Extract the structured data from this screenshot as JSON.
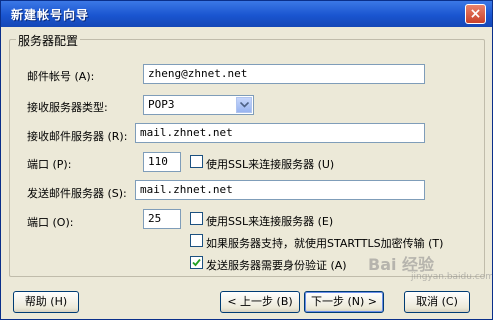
{
  "window": {
    "title": "新建帐号向导",
    "close_glyph": "×"
  },
  "group": {
    "title": "服务器配置"
  },
  "form": {
    "email_label": "邮件帐号 (A):",
    "email_value": "zheng@zhnet.net",
    "server_type_label": "接收服务器类型:",
    "server_type_value": "POP3",
    "incoming_label": "接收邮件服务器 (R):",
    "incoming_value": "mail.zhnet.net",
    "in_port_label": "端口 (P):",
    "in_port_value": "110",
    "in_ssl_label": "使用SSL来连接服务器 (U)",
    "in_ssl_checked": false,
    "outgoing_label": "发送邮件服务器 (S):",
    "outgoing_value": "mail.zhnet.net",
    "out_port_label": "端口 (O):",
    "out_port_value": "25",
    "out_ssl_label": "使用SSL来连接服务器 (E)",
    "out_ssl_checked": false,
    "starttls_label": "如果服务器支持，就使用STARTTLS加密传输 (T)",
    "starttls_checked": false,
    "auth_label": "发送服务器需要身份验证 (A)",
    "auth_checked": true
  },
  "buttons": {
    "help": "帮助 (H)",
    "back": "< 上一步 (B)",
    "next": "下一步 (N) >",
    "cancel": "取消 (C)"
  },
  "watermark": {
    "text": "Bai 经验",
    "url": "jingyan.baidu.com"
  },
  "icons": {
    "combo_arrow": "chevron-down-icon",
    "check_mark": "checkmark-icon",
    "close": "close-icon"
  }
}
